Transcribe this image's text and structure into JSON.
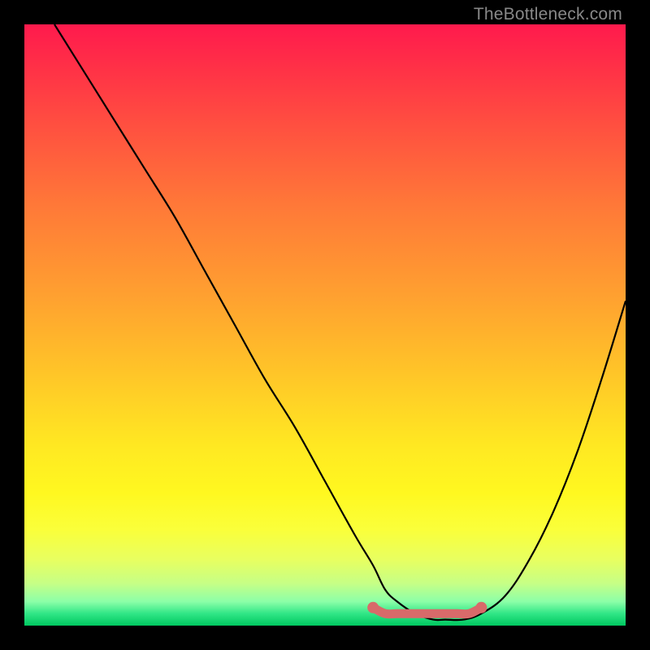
{
  "watermark": "TheBottleneck.com",
  "chart_data": {
    "type": "line",
    "title": "",
    "xlabel": "",
    "ylabel": "",
    "xlim": [
      0,
      100
    ],
    "ylim": [
      0,
      100
    ],
    "series": [
      {
        "name": "bottleneck-curve",
        "x": [
          5,
          10,
          15,
          20,
          25,
          30,
          35,
          40,
          45,
          50,
          55,
          58,
          60,
          62,
          65,
          68,
          70,
          73,
          76,
          80,
          84,
          88,
          92,
          96,
          100
        ],
        "values": [
          100,
          92,
          84,
          76,
          68,
          59,
          50,
          41,
          33,
          24,
          15,
          10,
          6,
          4,
          2,
          1,
          1,
          1,
          2,
          5,
          11,
          19,
          29,
          41,
          54
        ]
      },
      {
        "name": "optimal-range-marker",
        "x": [
          58,
          60,
          62,
          65,
          68,
          70,
          72,
          74,
          76
        ],
        "values": [
          3,
          2,
          2,
          2,
          2,
          2,
          2,
          2,
          3
        ]
      }
    ],
    "colors": {
      "curve": "#000000",
      "marker": "#d86a6a"
    }
  }
}
